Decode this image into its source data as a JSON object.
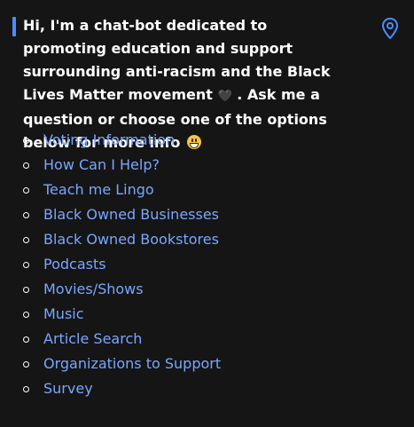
{
  "message": {
    "text_part1": "Hi, I'm a chat-bot dedicated to promoting education and support surrounding anti-racism and the Black Lives Matter movement",
    "heart": "🖤",
    "text_part2": ". Ask me a question or choose one of the options below for more info",
    "emoji_icon": "grinning-face-icon"
  },
  "location_icon": "map-pin-icon",
  "accent_color": "#4d8cff",
  "link_color": "#7aa6ff",
  "options": [
    {
      "label": "Voting Information"
    },
    {
      "label": "How Can I Help?"
    },
    {
      "label": "Teach me Lingo"
    },
    {
      "label": "Black Owned Businesses"
    },
    {
      "label": "Black Owned Bookstores"
    },
    {
      "label": "Podcasts"
    },
    {
      "label": "Movies/Shows"
    },
    {
      "label": "Music"
    },
    {
      "label": "Article Search"
    },
    {
      "label": "Organizations to Support"
    },
    {
      "label": "Survey"
    }
  ]
}
